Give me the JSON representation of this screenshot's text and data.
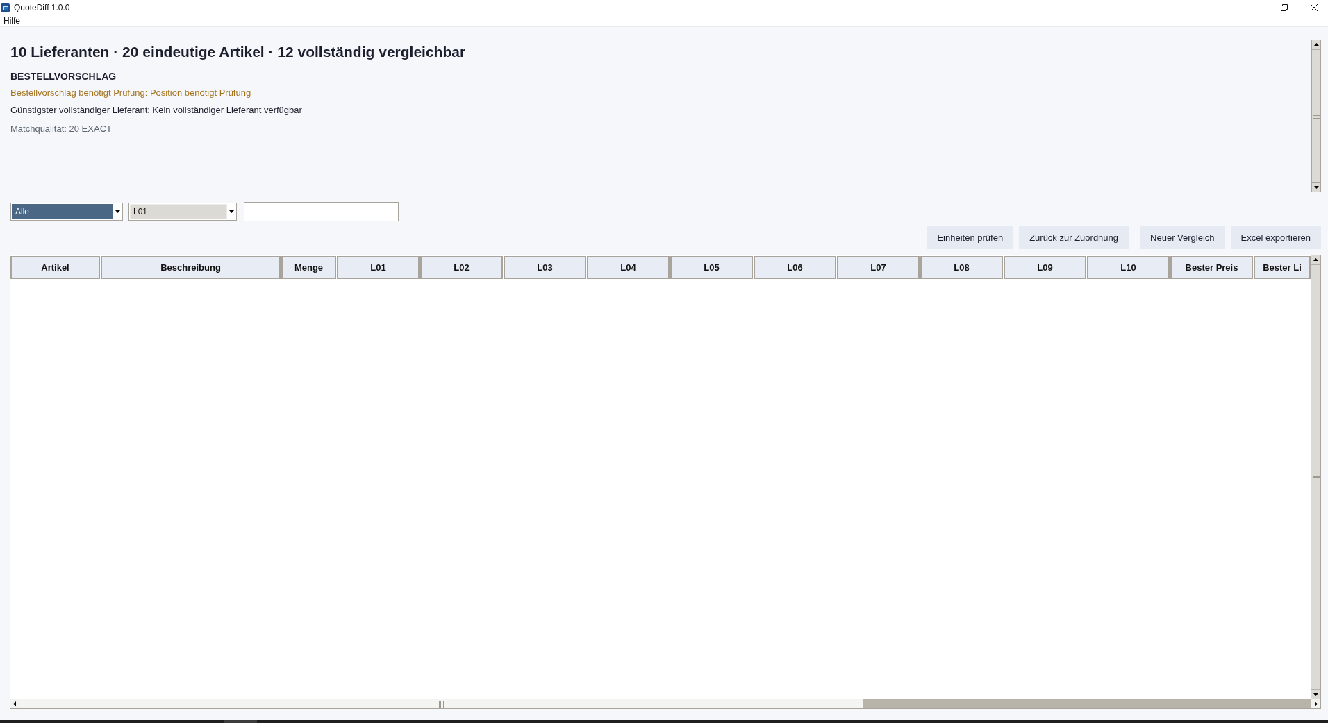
{
  "window": {
    "title": "QuoteDiff 1.0.0"
  },
  "menu": [
    {
      "label": "Hilfe"
    }
  ],
  "summary": {
    "heading": "10 Lieferanten · 20 eindeutige Artikel · 12 vollständig vergleichbar",
    "section_title": "BESTELLVORSCHLAG",
    "lines": [
      {
        "kind": "warning",
        "text": "Bestellvorschlag benötigt Prüfung: Position benötigt Prüfung"
      },
      {
        "kind": "info",
        "text": "Günstigster vollständiger Lieferant: Kein vollständiger Lieferant verfügbar"
      },
      {
        "kind": "muted",
        "text": "Matchqualität: 20 EXACT"
      }
    ]
  },
  "filters": {
    "status": {
      "value": "Alle",
      "focused": true
    },
    "supplier": {
      "value": "L01",
      "focused": false
    }
  },
  "button_groups": [
    [
      "Einheiten prüfen",
      "Zurück zur Zuordnung"
    ],
    [
      "Neuer Vergleich",
      "Excel exportieren"
    ]
  ],
  "table": {
    "columns": [
      "Artikel",
      "Beschreibung",
      "Menge",
      "L01",
      "L02",
      "L03",
      "L04",
      "L05",
      "L06",
      "L07",
      "L08",
      "L09",
      "L10",
      "Bester Preis",
      "Bester Li"
    ]
  }
}
